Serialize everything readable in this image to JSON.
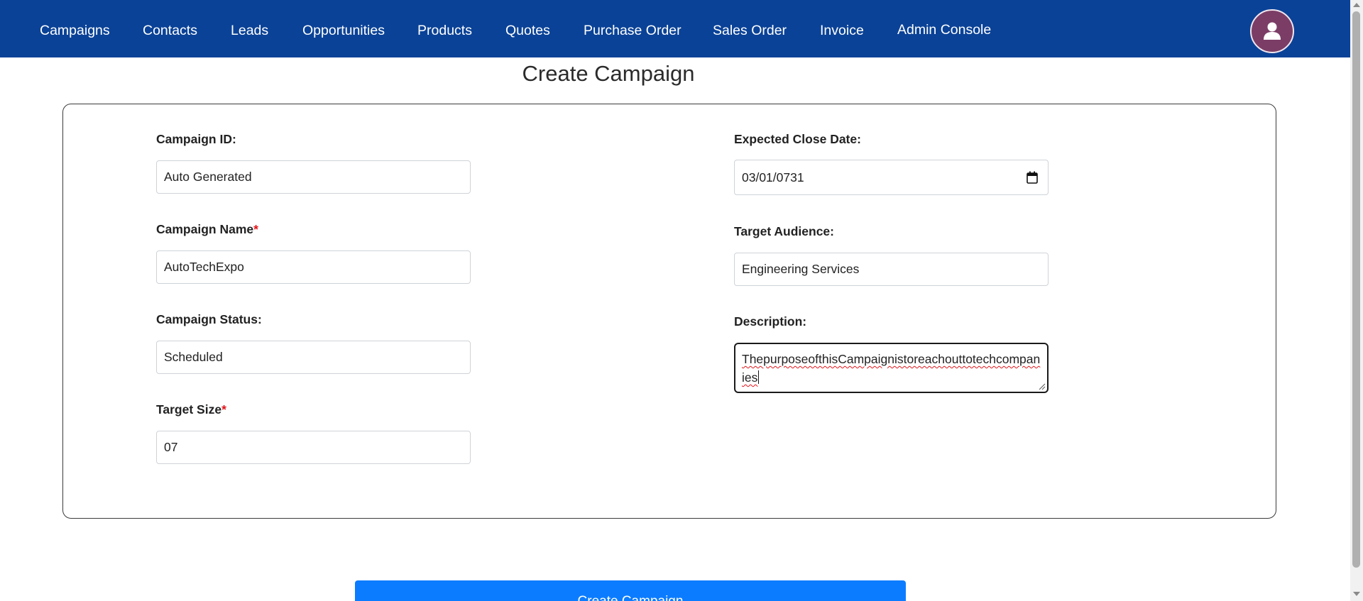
{
  "nav": {
    "items": [
      {
        "label": "Campaigns"
      },
      {
        "label": "Contacts"
      },
      {
        "label": "Leads"
      },
      {
        "label": "Opportunities"
      },
      {
        "label": "Products"
      },
      {
        "label": "Quotes"
      },
      {
        "label": "Purchase Order"
      },
      {
        "label": "Sales Order"
      },
      {
        "label": "Invoice"
      },
      {
        "label": "Admin Console"
      }
    ],
    "avatar_icon": "user-icon"
  },
  "page": {
    "title": "Create Campaign"
  },
  "form": {
    "campaign_id": {
      "label": "Campaign ID:",
      "value": "Auto Generated"
    },
    "campaign_name": {
      "label": "Campaign Name",
      "required_mark": "*",
      "value": "AutoTechExpo"
    },
    "campaign_status": {
      "label": "Campaign Status:",
      "value": "Scheduled"
    },
    "target_size": {
      "label": "Target Size",
      "required_mark": "*",
      "value": "07"
    },
    "expected_close_date": {
      "label": "Expected Close Date:",
      "value": "03/01/0731",
      "icon": "calendar-icon"
    },
    "target_audience": {
      "label": "Target Audience:",
      "value": "Engineering Services"
    },
    "description": {
      "label": "Description:",
      "value": "ThepurposeofthisCampaignistoreachouttotechcompanies"
    }
  },
  "submit": {
    "label": "Create Campaign"
  },
  "colors": {
    "nav_bg": "#0a4297",
    "avatar_bg": "#7b3d66",
    "button_bg": "#0b7cff",
    "required": "#e0151b"
  }
}
